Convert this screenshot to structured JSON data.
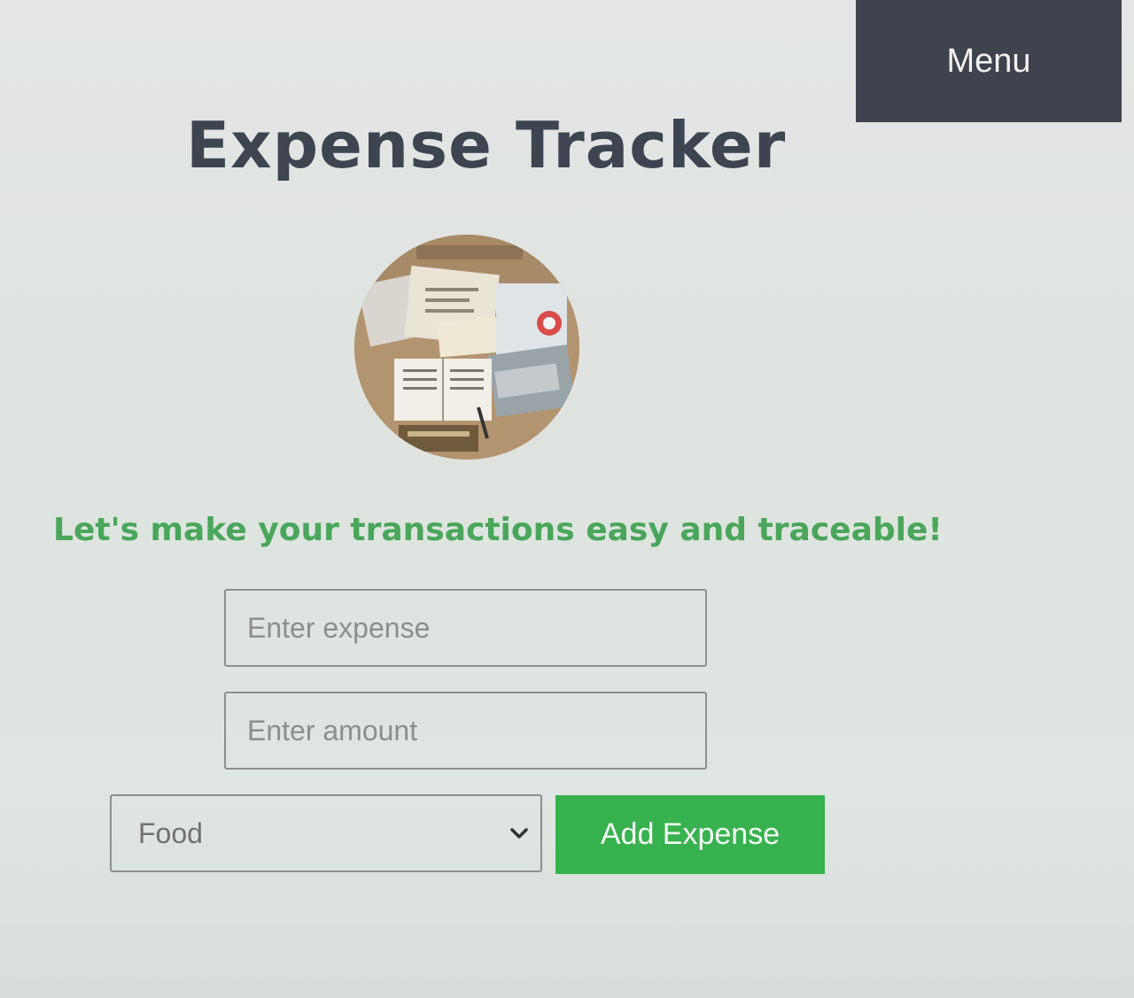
{
  "header": {
    "menu_label": "Menu",
    "title": "Expense Tracker"
  },
  "hero": {
    "image_icon": "expense-illustration-icon"
  },
  "tagline": "Let's make your transactions easy and traceable!",
  "form": {
    "expense_placeholder": "Enter expense",
    "amount_placeholder": "Enter amount",
    "category_selected": "Food",
    "add_button_label": "Add Expense"
  },
  "colors": {
    "menu_bg": "#3f434d",
    "title": "#3e4450",
    "tagline": "#4aa65a",
    "button_bg": "#38b24e"
  }
}
